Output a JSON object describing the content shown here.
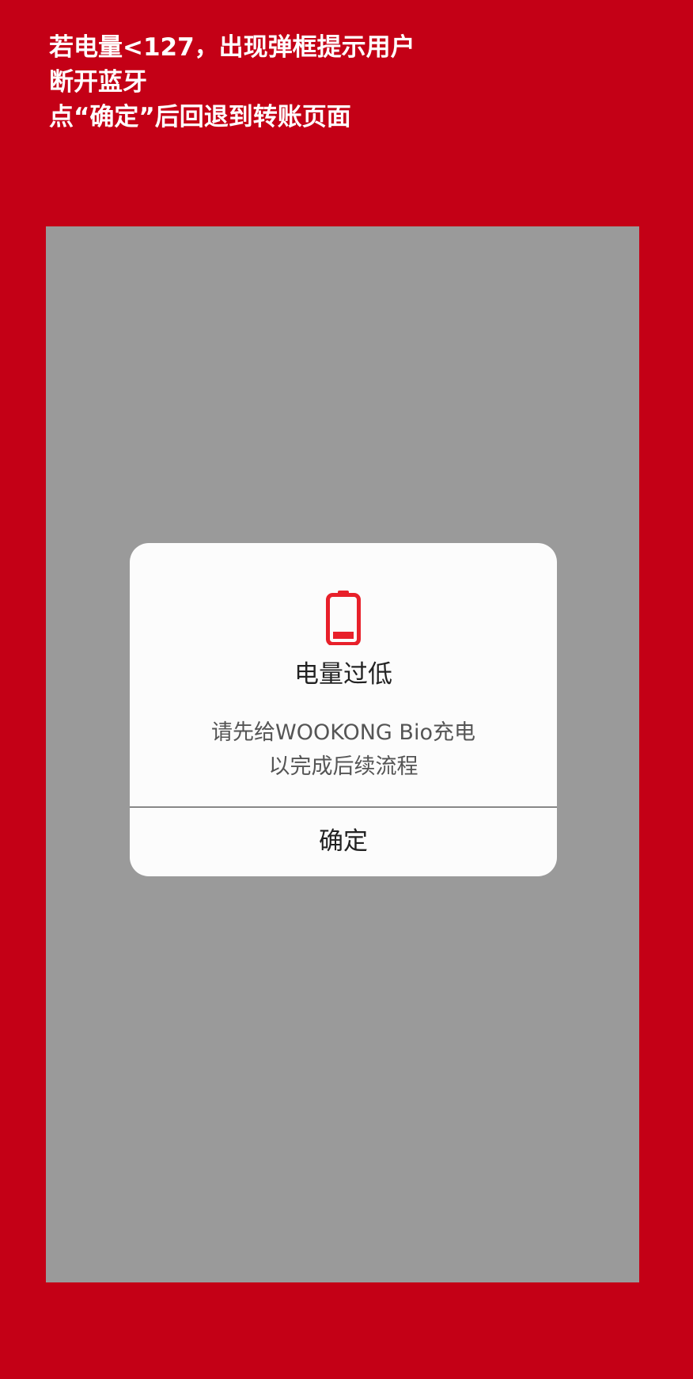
{
  "annotation": {
    "lines": [
      "若电量<127，出现弹框提示用户",
      "断开蓝牙",
      "点“确定”后回退到转账页面"
    ]
  },
  "dialog": {
    "icon": "battery-low-icon",
    "title": "电量过低",
    "message_lines": [
      "请先给WOOKONG Bio充电",
      "以完成后续流程"
    ],
    "confirm_label": "确定"
  },
  "colors": {
    "background": "#c40016",
    "overlay": "#9a9a9a",
    "dialog": "#fcfcfc",
    "battery": "#e8202a"
  }
}
